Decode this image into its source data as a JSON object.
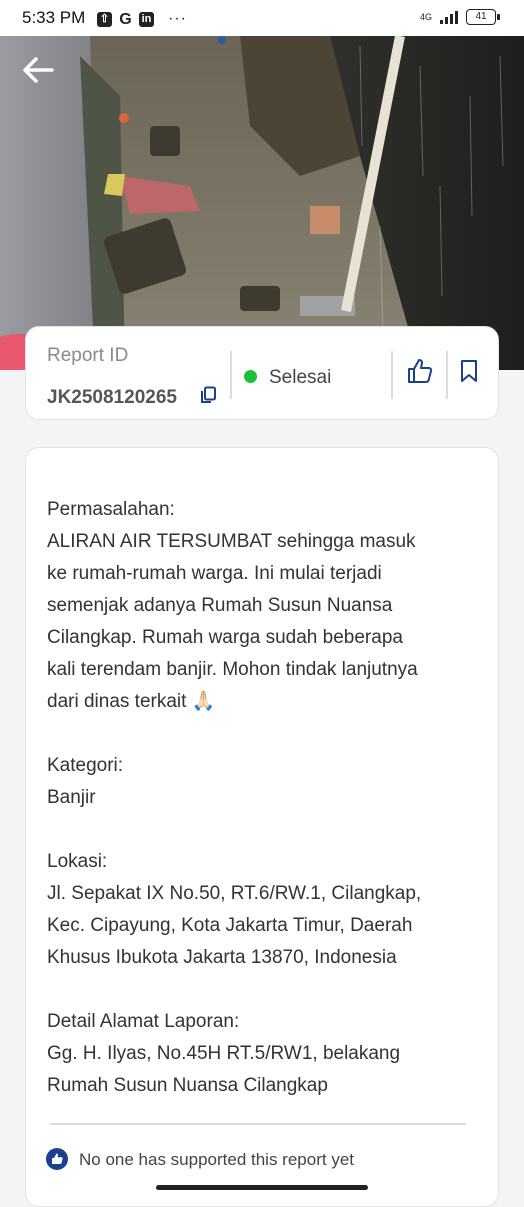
{
  "status_bar": {
    "time": "5:33 PM",
    "network": "4G",
    "battery": "41",
    "overflow": "···"
  },
  "hero": {
    "image_description": "flooded alley with debris"
  },
  "report": {
    "id_label": "Report ID",
    "id_value": "JK2508120265",
    "status": "Selesai",
    "status_color": "#1fbf3a"
  },
  "detail": {
    "problem_label": "Permasalahan:",
    "problem_text": "ALIRAN AIR TERSUMBAT sehingga masuk\nke rumah-rumah warga. Ini mulai terjadi\nsemenjak adanya Rumah Susun Nuansa\nCilangkap. Rumah warga sudah beberapa\nkali terendam banjir. Mohon tindak lanjutnya\ndari dinas terkait 🙏🏻",
    "category_label": "Kategori:",
    "category_value": "Banjir",
    "location_label": "Lokasi:",
    "location_value": "Jl. Sepakat IX No.50, RT.6/RW.1, Cilangkap,\nKec. Cipayung, Kota Jakarta Timur, Daerah\nKhusus Ibukota Jakarta 13870, Indonesia",
    "address_label": "Detail Alamat Laporan:",
    "address_value": "Gg. H. Ilyas, No.45H RT.5/RW1, belakang\nRumah Susun Nuansa Cilangkap"
  },
  "support": {
    "text": "No one has supported this report yet"
  },
  "colors": {
    "accent": "#1c3f8f",
    "status_green": "#1fbf3a"
  }
}
